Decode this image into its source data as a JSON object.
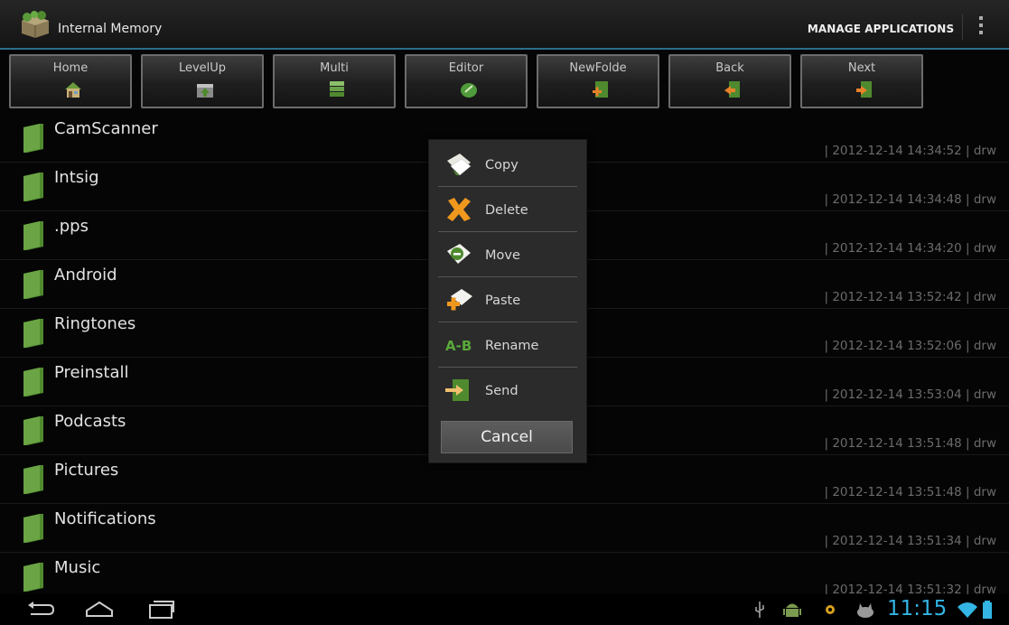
{
  "actionbar": {
    "title": "Internal Memory",
    "manage_label": "MANAGE APPLICATIONS"
  },
  "toolbar": {
    "buttons": [
      {
        "label": "Home",
        "icon": "home-icon"
      },
      {
        "label": "LevelUp",
        "icon": "level-up-icon"
      },
      {
        "label": "Multi",
        "icon": "multi-select-icon"
      },
      {
        "label": "Editor",
        "icon": "editor-icon"
      },
      {
        "label": "NewFolde",
        "icon": "new-folder-icon"
      },
      {
        "label": "Back",
        "icon": "back-icon"
      },
      {
        "label": "Next",
        "icon": "next-icon"
      }
    ]
  },
  "files": [
    {
      "name": "CamScanner",
      "meta": "| 2012-12-14 14:34:52 | drw"
    },
    {
      "name": "Intsig",
      "meta": "| 2012-12-14 14:34:48 | drw"
    },
    {
      "name": ".pps",
      "meta": "| 2012-12-14 14:34:20 | drw"
    },
    {
      "name": "Android",
      "meta": "| 2012-12-14 13:52:42 | drw"
    },
    {
      "name": "Ringtones",
      "meta": "| 2012-12-14 13:52:06 | drw"
    },
    {
      "name": "Preinstall",
      "meta": "| 2012-12-14 13:53:04 | drw"
    },
    {
      "name": "Podcasts",
      "meta": "| 2012-12-14 13:51:48 | drw"
    },
    {
      "name": "Pictures",
      "meta": "| 2012-12-14 13:51:48 | drw"
    },
    {
      "name": "Notifications",
      "meta": "| 2012-12-14 13:51:34 | drw"
    },
    {
      "name": "Music",
      "meta": "| 2012-12-14 13:51:32 | drw"
    }
  ],
  "context_menu": {
    "items": [
      {
        "label": "Copy",
        "icon": "copy-icon"
      },
      {
        "label": "Delete",
        "icon": "delete-icon"
      },
      {
        "label": "Move",
        "icon": "move-icon"
      },
      {
        "label": "Paste",
        "icon": "paste-icon"
      },
      {
        "label": "Rename",
        "icon": "rename-icon"
      },
      {
        "label": "Send",
        "icon": "send-icon"
      }
    ],
    "cancel_label": "Cancel"
  },
  "statusbar": {
    "time": "11:15"
  },
  "colors": {
    "accent": "#33b5e5",
    "actionbar_underline": "#2b6f8a",
    "folder_green": "#4f8a2f"
  }
}
